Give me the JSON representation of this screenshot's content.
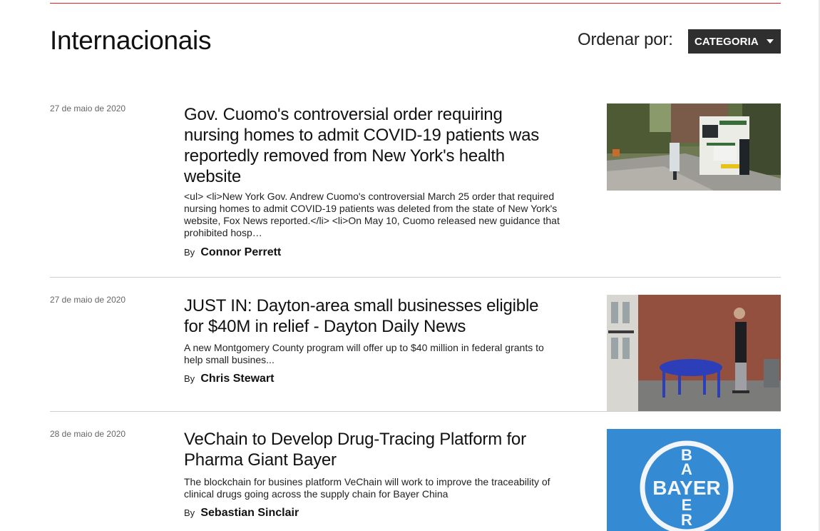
{
  "section": {
    "title": "Internacionais",
    "sort_label": "Ordenar por:",
    "sort_value": "CATEGORIA"
  },
  "colors": {
    "accent_rule": "#e0241c",
    "select_bg": "#2f2f2f"
  },
  "articles": [
    {
      "date": "27 de maio de 2020",
      "title": "Gov. Cuomo's controversial order requiring nursing homes to admit COVID-19 patients was reportedly removed from New York's health website",
      "summary": "<ul> <li>New York Gov. Andrew Cuomo's controversial March 25 order that required nursing homes to admit COVID-19 patients was deleted from the state of New York's website, Fox News reported.</li> <li>On May 10, Cuomo released new guidance that prohibited hosp…",
      "by": "By",
      "author": "Connor Perrett",
      "image": "ambulance-photo"
    },
    {
      "date": "27 de maio de 2020",
      "title": "JUST IN: Dayton-area small businesses eligible for $40M in relief - Dayton Daily News",
      "summary": "A new Montgomery County program will offer up to $40 million in federal grants to help small busines...",
      "by": "By",
      "author": "Chris Stewart",
      "image": "patio-photo"
    },
    {
      "date": "28 de maio de 2020",
      "title": "VeChain to Develop Drug-Tracing Platform for Pharma Giant Bayer",
      "summary": "The blockchain for busines platform VeChain will work to improve the traceability of clinical drugs going across the supply chain for Bayer China",
      "by": "By",
      "author": "Sebastian Sinclair",
      "image": "bayer-logo-photo",
      "logo_text": "BAYER"
    }
  ]
}
